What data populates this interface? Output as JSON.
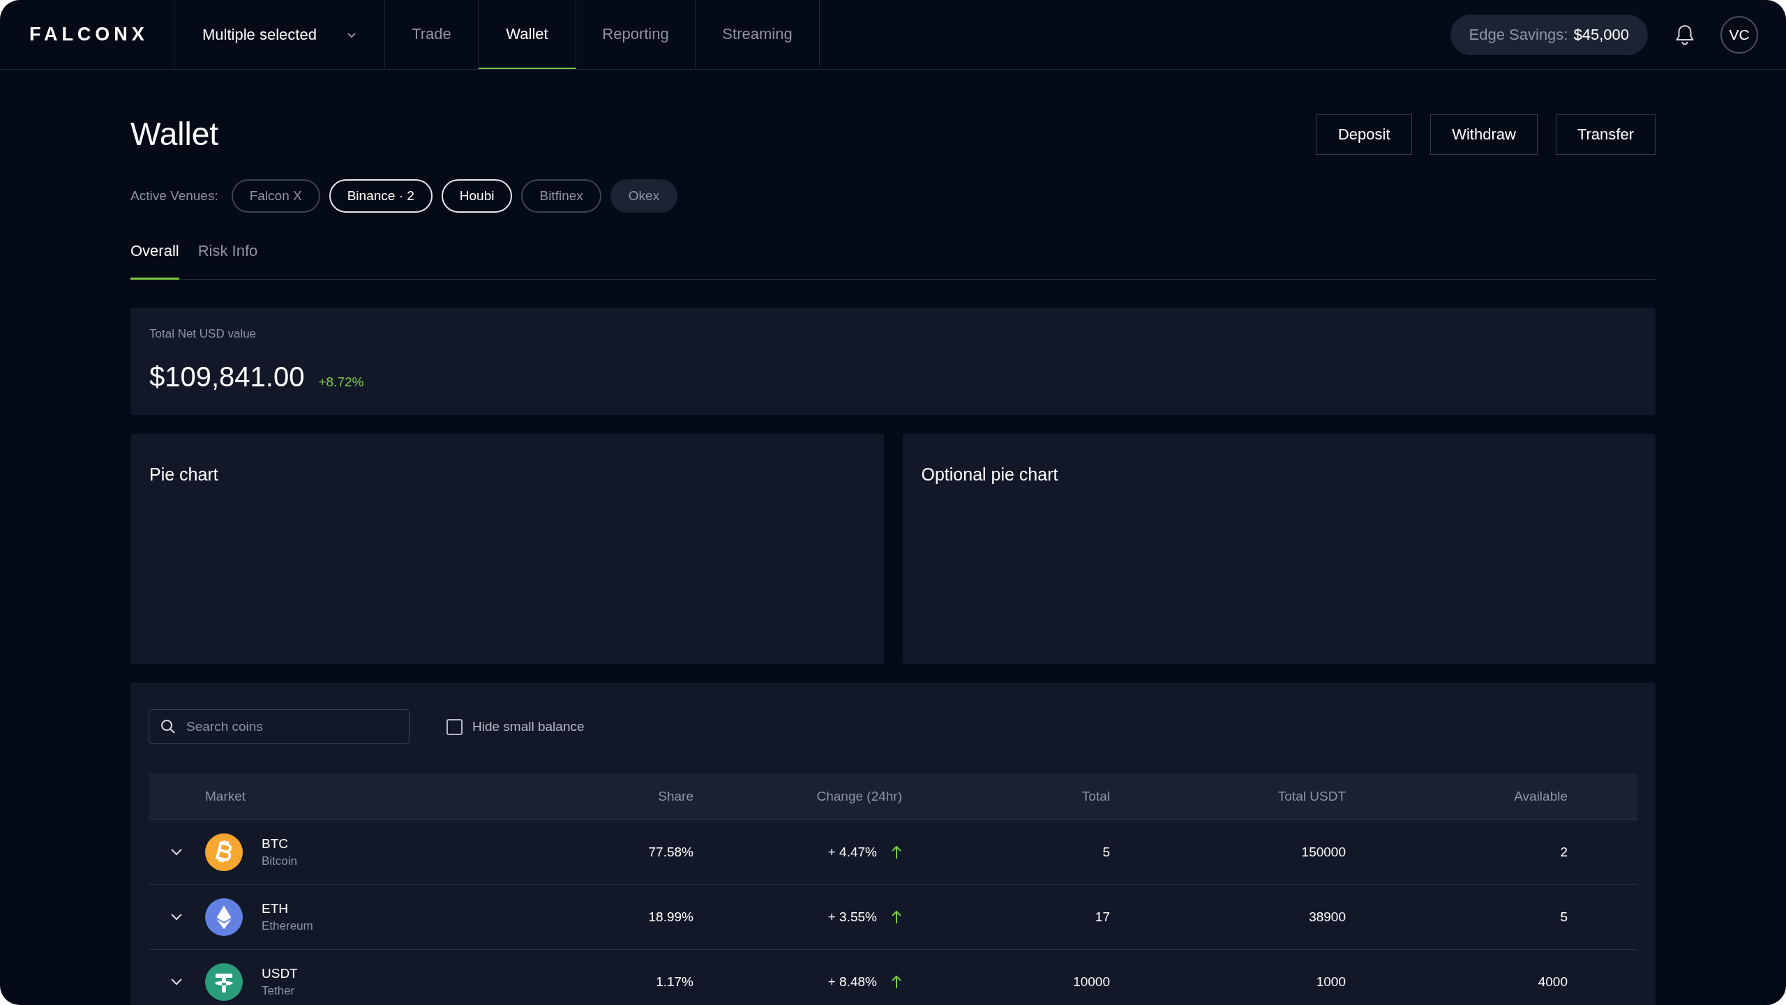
{
  "header": {
    "logo": "FALCONX",
    "account_selector": "Multiple selected",
    "nav": [
      {
        "label": "Trade",
        "selected": false
      },
      {
        "label": "Wallet",
        "selected": true
      },
      {
        "label": "Reporting",
        "selected": false
      },
      {
        "label": "Streaming",
        "selected": false
      }
    ],
    "savings_label": "Edge Savings:",
    "savings_value": "$45,000",
    "avatar": "VC"
  },
  "page": {
    "title": "Wallet",
    "actions": [
      "Deposit",
      "Withdraw",
      "Transfer"
    ],
    "venues_label": "Active Venues:",
    "venues": [
      {
        "label": "Falcon X",
        "selected": false,
        "disabled": false
      },
      {
        "label": "Binance · 2",
        "selected": true,
        "disabled": false
      },
      {
        "label": "Houbi",
        "selected": true,
        "disabled": false
      },
      {
        "label": "Bitfinex",
        "selected": false,
        "disabled": false
      },
      {
        "label": "Okex",
        "selected": false,
        "disabled": true
      }
    ],
    "tabs": [
      {
        "label": "Overall",
        "selected": true
      },
      {
        "label": "Risk Info",
        "selected": false
      }
    ]
  },
  "summary": {
    "label": "Total Net USD value",
    "value": "$109,841.00",
    "change": "+8.72%"
  },
  "panels": [
    {
      "title": "Pie chart"
    },
    {
      "title": "Optional pie chart"
    }
  ],
  "table": {
    "search": {
      "placeholder": "Search coins"
    },
    "hide_small_balance": {
      "label": "Hide small balance",
      "checked": false
    },
    "columns": [
      "Market",
      "Share",
      "Change (24hr)",
      "Total",
      "Total USDT",
      "Available"
    ],
    "rows": [
      {
        "kind": "btc",
        "color": "#f7a731",
        "symbol": "BTC",
        "name": "Bitcoin",
        "share": "77.58%",
        "change": "+ 4.47%",
        "total": "5",
        "total_usdt": "150000",
        "available": "2",
        "expanded": false
      },
      {
        "kind": "eth",
        "color": "#6281e3",
        "symbol": "ETH",
        "name": "Ethereum",
        "share": "18.99%",
        "change": "+ 3.55%",
        "total": "17",
        "total_usdt": "38900",
        "available": "5",
        "expanded": false
      },
      {
        "kind": "usdt",
        "color": "#2a9d7a",
        "symbol": "USDT",
        "name": "Tether",
        "share": "1.17%",
        "change": "+ 8.48%",
        "total": "10000",
        "total_usdt": "1000",
        "available": "4000",
        "expanded": false
      }
    ]
  }
}
